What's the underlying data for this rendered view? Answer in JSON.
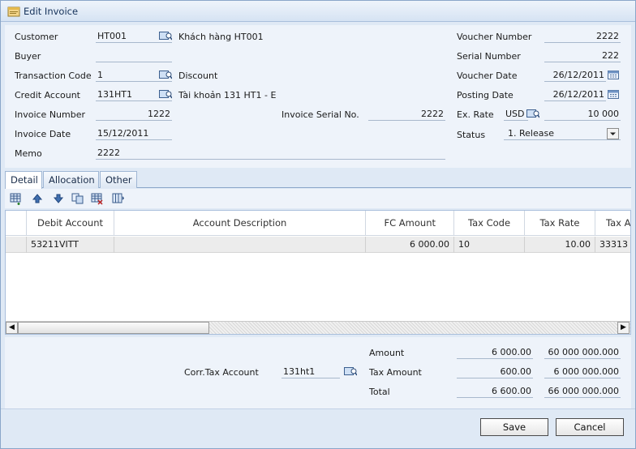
{
  "window": {
    "title": "Edit Invoice"
  },
  "form": {
    "customer_label": "Customer",
    "customer_code": "HT001",
    "customer_name": "Khách hàng HT001",
    "buyer_label": "Buyer",
    "buyer_value": "",
    "transaction_label": "Transaction Code",
    "transaction_code": "1",
    "transaction_name": "Discount",
    "credit_label": "Credit Account",
    "credit_code": "131HT1",
    "credit_name": "Tài khoản 131 HT1 - E",
    "invoice_number_label": "Invoice Number",
    "invoice_number": "1222",
    "invoice_serial_label": "Invoice Serial No.",
    "invoice_serial": "2222",
    "invoice_date_label": "Invoice Date",
    "invoice_date": "15/12/2011",
    "memo_label": "Memo",
    "memo": "2222",
    "voucher_number_label": "Voucher Number",
    "voucher_number": "2222",
    "serial_number_label": "Serial Number",
    "serial_number": "222",
    "voucher_date_label": "Voucher Date",
    "voucher_date": "26/12/2011",
    "posting_date_label": "Posting Date",
    "posting_date": "26/12/2011",
    "ex_rate_label": "Ex. Rate",
    "currency": "USD",
    "ex_rate": "10 000",
    "status_label": "Status",
    "status": "1. Release"
  },
  "tabs": [
    {
      "label": "Detail",
      "active": true
    },
    {
      "label": "Allocation",
      "active": false
    },
    {
      "label": "Other",
      "active": false
    }
  ],
  "toolbar": {
    "icons": [
      "add-row-icon",
      "move-up-icon",
      "move-down-icon",
      "copy-row-icon",
      "delete-row-icon",
      "columns-icon"
    ]
  },
  "grid": {
    "headers": [
      "Debit Account",
      "Account Description",
      "FC Amount",
      "Tax Code",
      "Tax Rate",
      "Tax A"
    ],
    "rows": [
      {
        "debit_account": "53211VITT",
        "description": "",
        "fc_amount": "6 000.00",
        "tax_code": "10",
        "tax_rate": "10.00",
        "tax_account": "33313"
      }
    ]
  },
  "summary": {
    "corr_tax_label": "Corr.Tax Account",
    "corr_tax_value": "131ht1",
    "amount_label": "Amount",
    "amount_fc": "6 000.00",
    "amount_lc": "60 000 000.000",
    "tax_amount_label": "Tax Amount",
    "tax_fc": "600.00",
    "tax_lc": "6 000 000.000",
    "total_label": "Total",
    "total_fc": "6 600.00",
    "total_lc": "66 000 000.000"
  },
  "buttons": {
    "save": "Save",
    "cancel": "Cancel"
  },
  "colors": {
    "window_bg": "#dfe9f5",
    "panel_bg": "#eef3fa",
    "border": "#8aa6c9"
  }
}
